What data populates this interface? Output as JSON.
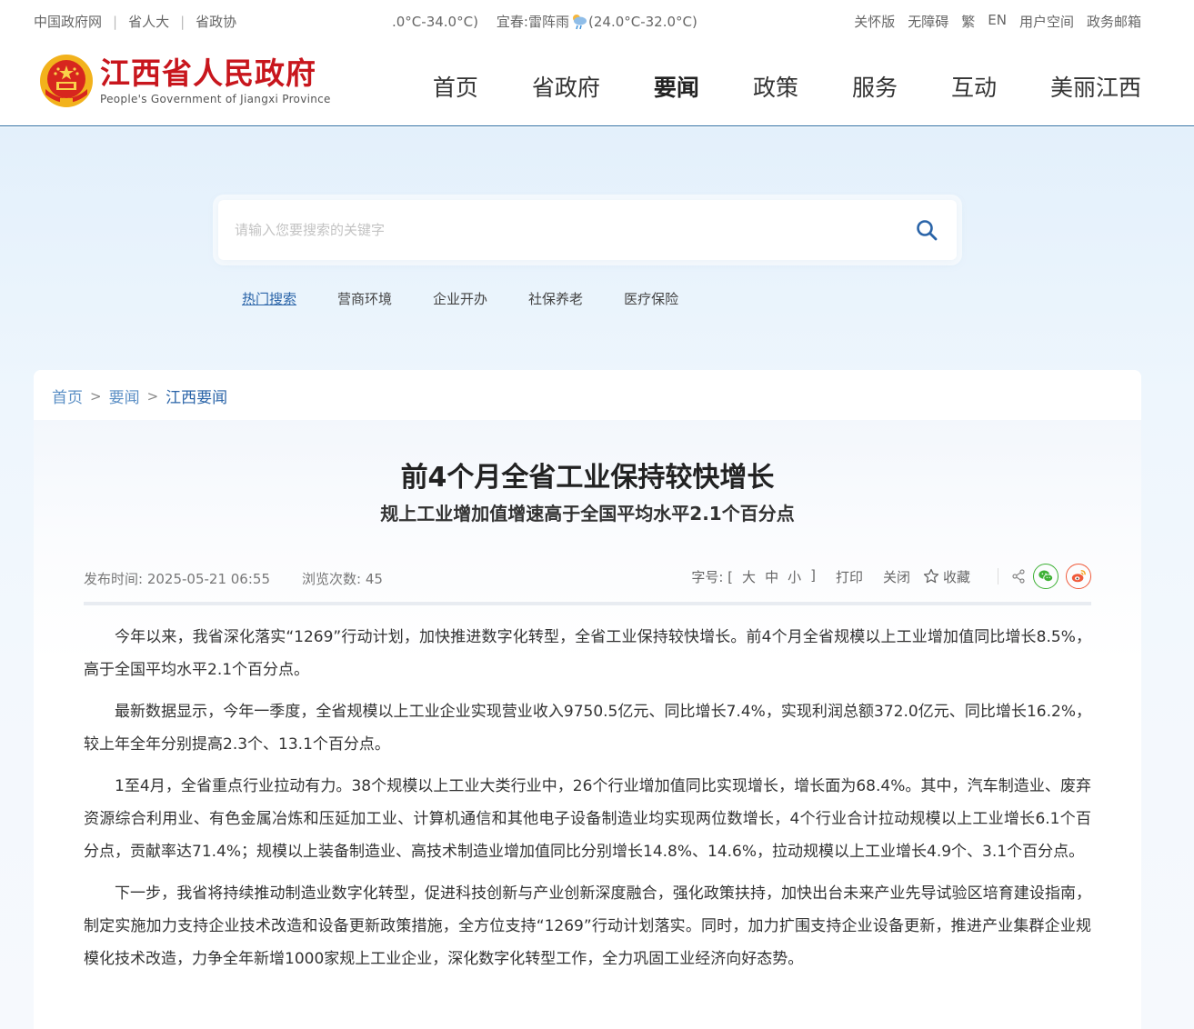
{
  "topbar": {
    "links_left": [
      "中国政府网",
      "省人大",
      "省政协"
    ],
    "weather_temp": ".0°C-34.0°C)",
    "city": "宜春:",
    "weather_desc": "雷阵雨",
    "weather_range": "(24.0°C-32.0°C)",
    "links_right": [
      "关怀版",
      "无障碍",
      "繁",
      "EN",
      "用户空间",
      "政务邮箱"
    ]
  },
  "header": {
    "logo_cn": "江西省人民政府",
    "logo_en": "People's Government of Jiangxi Province",
    "nav": [
      "首页",
      "省政府",
      "要闻",
      "政策",
      "服务",
      "互动",
      "美丽江西"
    ],
    "active_nav": "要闻"
  },
  "search": {
    "placeholder": "请输入您要搜索的关键字",
    "hot_label": "热门搜索",
    "hot_items": [
      "营商环境",
      "企业开办",
      "社保养老",
      "医疗保险"
    ]
  },
  "breadcrumb": [
    "首页",
    "要闻",
    "江西要闻"
  ],
  "article": {
    "title": "前4个月全省工业保持较快增长",
    "subtitle": "规上工业增加值增速高于全国平均水平2.1个百分点",
    "publish": "发布时间: 2025-05-21 06:55",
    "views": "浏览次数: 45",
    "font_label": "字号: [",
    "font_sizes": [
      "大",
      "中",
      "小"
    ],
    "font_end": "]",
    "print": "打印",
    "close": "关闭",
    "favorite": "收藏",
    "paragraphs": [
      "今年以来，我省深化落实“1269”行动计划，加快推进数字化转型，全省工业保持较快增长。前4个月全省规模以上工业增加值同比增长8.5%，高于全国平均水平2.1个百分点。",
      "最新数据显示，今年一季度，全省规模以上工业企业实现营业收入9750.5亿元、同比增长7.4%，实现利润总额372.0亿元、同比增长16.2%，较上年全年分别提高2.3个、13.1个百分点。",
      "1至4月，全省重点行业拉动有力。38个规模以上工业大类行业中，26个行业增加值同比实现增长，增长面为68.4%。其中，汽车制造业、废弃资源综合利用业、有色金属冶炼和压延加工业、计算机通信和其他电子设备制造业均实现两位数增长，4个行业合计拉动规模以上工业增长6.1个百分点，贡献率达71.4%；规模以上装备制造业、高技术制造业增加值同比分别增长14.8%、14.6%，拉动规模以上工业增长4.9个、3.1个百分点。",
      "下一步，我省将持续推动制造业数字化转型，促进科技创新与产业创新深度融合，强化政策扶持，加快出台未来产业先导试验区培育建设指南，制定实施加力支持企业技术改造和设备更新政策措施，全方位支持“1269”行动计划落实。同时，加力扩围支持企业设备更新，推进产业集群企业规模化技术改造，力争全年新增1000家规上工业企业，深化数字化转型工作，全力巩固工业经济向好态势。"
    ]
  },
  "colors": {
    "brand_red": "#c8161d",
    "link_blue": "#2a64a8",
    "header_rule": "#2c6ea3"
  }
}
